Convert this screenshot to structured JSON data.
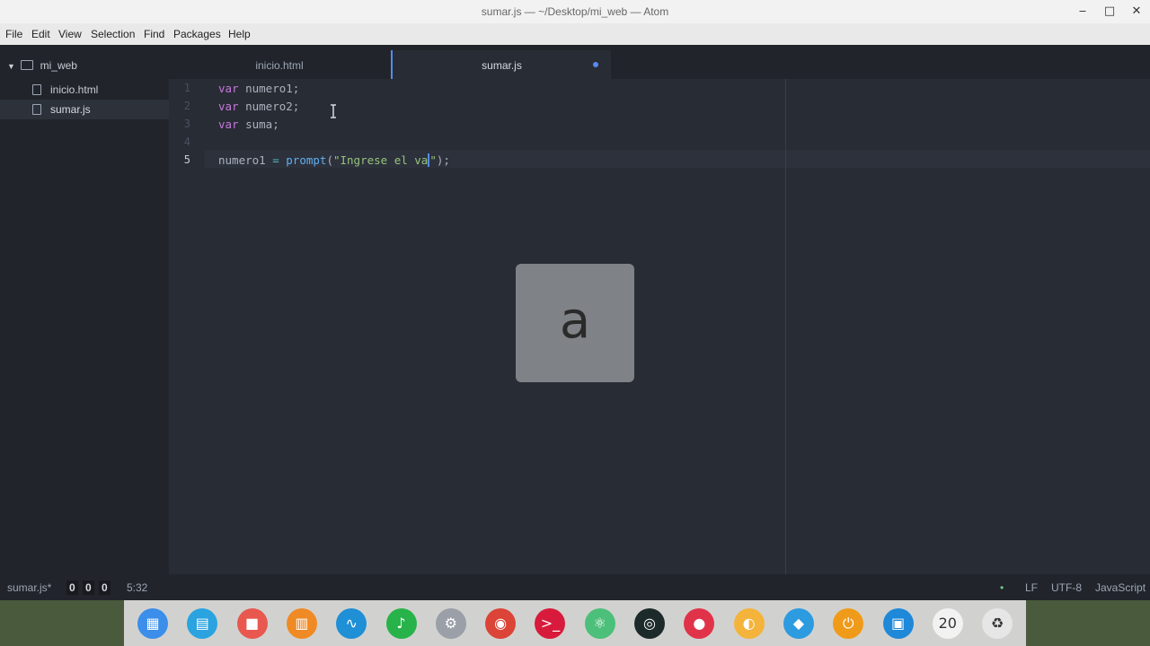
{
  "window": {
    "title": "sumar.js — ~/Desktop/mi_web — Atom"
  },
  "menu": [
    "File",
    "Edit",
    "View",
    "Selection",
    "Find",
    "Packages",
    "Help"
  ],
  "tree": {
    "root": "mi_web",
    "files": [
      {
        "name": "inicio.html",
        "selected": false
      },
      {
        "name": "sumar.js",
        "selected": true
      }
    ]
  },
  "tabs": [
    {
      "label": "inicio.html",
      "active": false,
      "modified": false
    },
    {
      "label": "sumar.js",
      "active": true,
      "modified": true
    }
  ],
  "editor": {
    "line_numbers": [
      "1",
      "2",
      "3",
      "4",
      "5"
    ],
    "current_line": 5,
    "lines": [
      [
        {
          "t": "var",
          "c": "kw"
        },
        {
          "t": " numero1;",
          "c": ""
        }
      ],
      [
        {
          "t": "var",
          "c": "kw"
        },
        {
          "t": " numero2;",
          "c": ""
        }
      ],
      [
        {
          "t": "var",
          "c": "kw"
        },
        {
          "t": " suma;",
          "c": ""
        }
      ],
      [],
      [
        {
          "t": "numero1 ",
          "c": ""
        },
        {
          "t": "=",
          "c": "op"
        },
        {
          "t": " ",
          "c": ""
        },
        {
          "t": "prompt",
          "c": "fn"
        },
        {
          "t": "(",
          "c": ""
        },
        {
          "t": "\"Ingrese el va",
          "c": "str"
        },
        {
          "t": "CARET",
          "c": "caret"
        },
        {
          "t": "\"",
          "c": "str"
        },
        {
          "t": ");",
          "c": ""
        }
      ]
    ]
  },
  "key_overlay": {
    "key": "a"
  },
  "status": {
    "file": "sumar.js*",
    "counts": [
      "0",
      "0",
      "0"
    ],
    "position": "5:32",
    "line_ending": "LF",
    "encoding": "UTF-8",
    "grammar": "JavaScript"
  },
  "dock": {
    "icons": [
      {
        "name": "launcher-icon",
        "color": "#3b8eea",
        "glyph": "▦"
      },
      {
        "name": "file-manager-icon",
        "color": "#2aa3e0",
        "glyph": "▤"
      },
      {
        "name": "video-icon",
        "color": "#e8584f",
        "glyph": "■"
      },
      {
        "name": "store-icon",
        "color": "#f08a24",
        "glyph": "▥"
      },
      {
        "name": "system-monitor-icon",
        "color": "#1f8fd6",
        "glyph": "∿"
      },
      {
        "name": "music-icon",
        "color": "#27b34a",
        "glyph": "♪"
      },
      {
        "name": "settings-icon",
        "color": "#9a9fa8",
        "glyph": "⚙"
      },
      {
        "name": "chrome-icon",
        "color": "#db4437",
        "glyph": "◉"
      },
      {
        "name": "terminal-icon",
        "color": "#d81b3c",
        "glyph": ">_"
      },
      {
        "name": "atom-icon",
        "color": "#4cbf7a",
        "glyph": "⚛"
      },
      {
        "name": "camera-icon",
        "color": "#1d2a2a",
        "glyph": "◎"
      },
      {
        "name": "screen-record-icon",
        "color": "#e0334a",
        "glyph": "●"
      },
      {
        "name": "browser-icon",
        "color": "#f4b33a",
        "glyph": "◐"
      },
      {
        "name": "wifi-icon",
        "color": "#2d9be0",
        "glyph": "◆"
      },
      {
        "name": "power-icon",
        "color": "#f09a1a",
        "glyph": "⏻"
      },
      {
        "name": "screenshot-icon",
        "color": "#1e88d9",
        "glyph": "▣"
      },
      {
        "name": "clock-icon",
        "color": "#f2f2f2",
        "glyph": "20"
      },
      {
        "name": "trash-icon",
        "color": "#e6e6e6",
        "glyph": "♻"
      }
    ]
  }
}
